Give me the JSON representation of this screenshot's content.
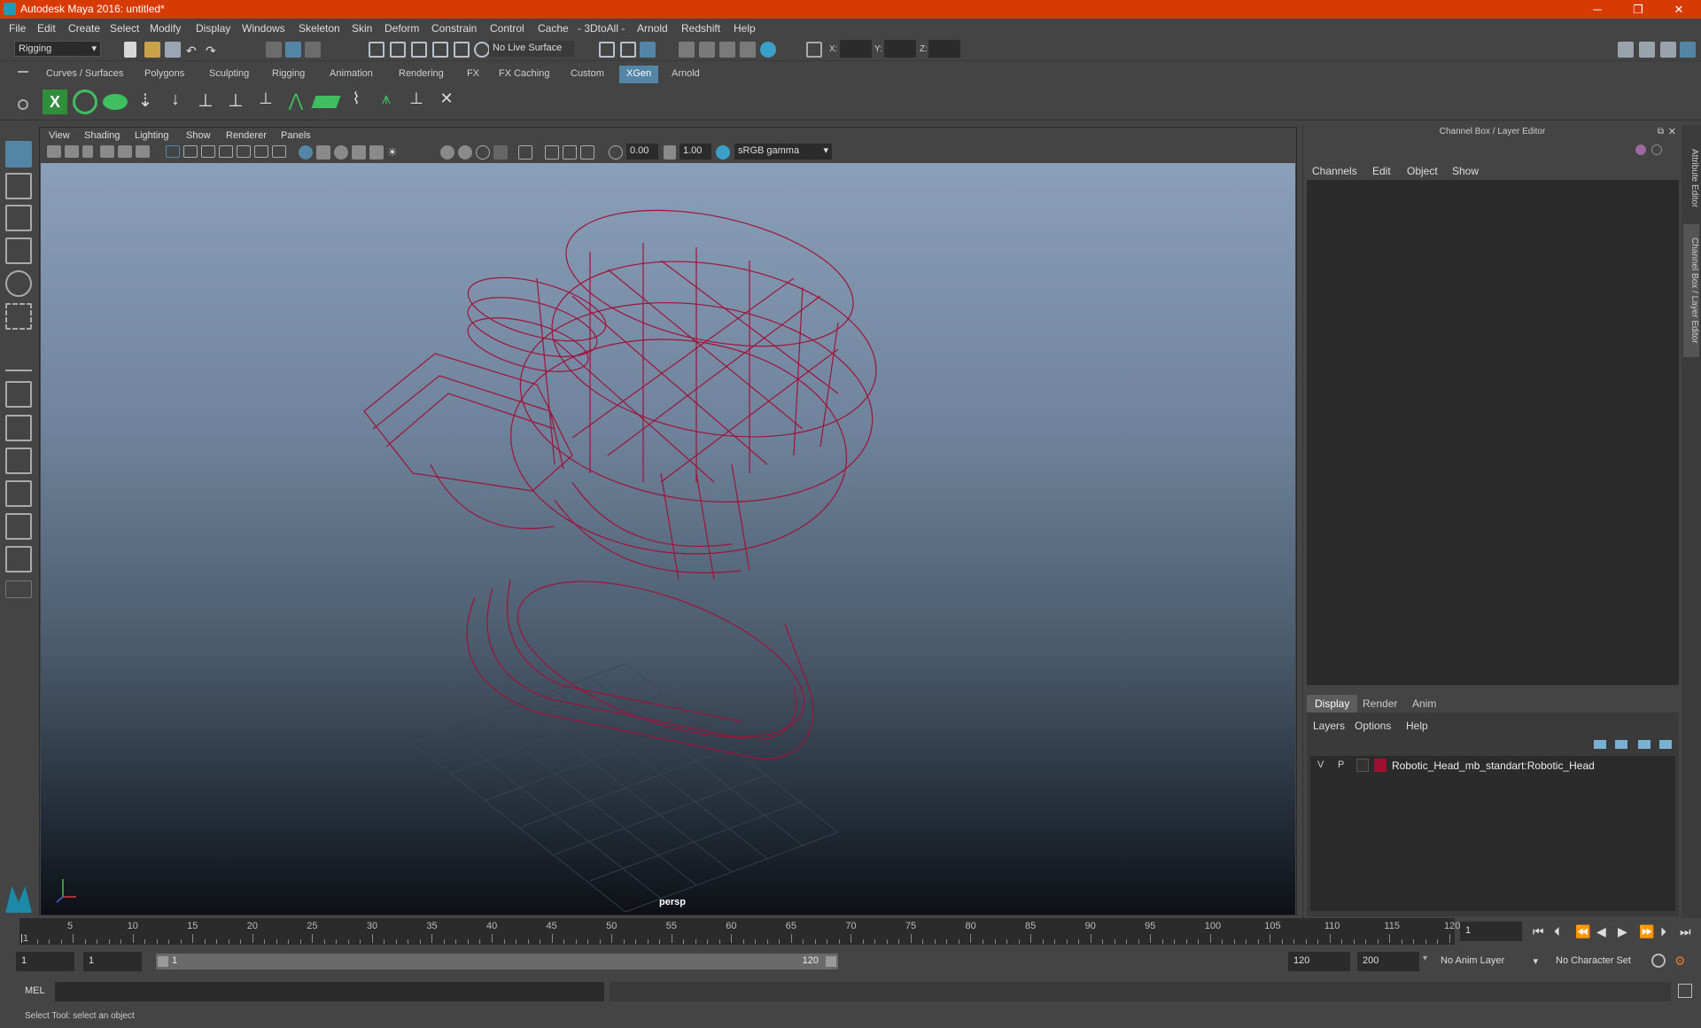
{
  "window": {
    "title": "Autodesk Maya 2016: untitled*",
    "minimize": "─",
    "maximize": "❐",
    "close": "✕"
  },
  "menubar": [
    "File",
    "Edit",
    "Create",
    "Select",
    "Modify",
    "Display",
    "Windows",
    "Skeleton",
    "Skin",
    "Deform",
    "Constrain",
    "Control",
    "Cache",
    "- 3DtoAll -",
    "Arnold",
    "Redshift",
    "Help"
  ],
  "statusline": {
    "menuset": "Rigging",
    "live_surface": "No Live Surface",
    "x_label": "X:",
    "y_label": "Y:",
    "z_label": "Z:"
  },
  "shelf_tabs": [
    "Curves / Surfaces",
    "Polygons",
    "Sculpting",
    "Rigging",
    "Animation",
    "Rendering",
    "FX",
    "FX Caching",
    "Custom",
    "XGen",
    "Arnold"
  ],
  "active_shelf": "XGen",
  "panel": {
    "menu": [
      "View",
      "Shading",
      "Lighting",
      "Show",
      "Renderer",
      "Panels"
    ],
    "exposure": "0.00",
    "gamma": "1.00",
    "colorspace": "sRGB gamma",
    "camera_label": "persp"
  },
  "channelbox": {
    "title": "Channel Box / Layer Editor",
    "menu": [
      "Channels",
      "Edit",
      "Object",
      "Show"
    ],
    "layer_tabs": [
      "Display",
      "Render",
      "Anim"
    ],
    "layer_menu": [
      "Layers",
      "Options",
      "Help"
    ],
    "layers": [
      {
        "v": "V",
        "p": "P",
        "name": "Robotic_Head_mb_standart:Robotic_Head",
        "color": "#9e1030"
      }
    ]
  },
  "side_tabs": [
    "Attribute Editor",
    "Channel Box / Layer Editor"
  ],
  "timeline": {
    "ticks": [
      "5",
      "10",
      "15",
      "20",
      "25",
      "30",
      "35",
      "40",
      "45",
      "50",
      "55",
      "60",
      "65",
      "70",
      "75",
      "80",
      "85",
      "90",
      "95",
      "100",
      "105",
      "110",
      "115",
      "120"
    ],
    "current_frame": "1",
    "start_marker": "1"
  },
  "range": {
    "start": "1",
    "inner_start": "1",
    "slider_start": "1",
    "slider_end": "120",
    "end": "120",
    "max": "200",
    "anim_layer": "No Anim Layer",
    "char_set": "No Character Set"
  },
  "cmdline": {
    "label": "MEL"
  },
  "helpline": {
    "text": "Select Tool: select an object"
  },
  "colors": {
    "wire": "#a0123a",
    "accent": "#5285a6",
    "titlebar": "#d83b01"
  }
}
